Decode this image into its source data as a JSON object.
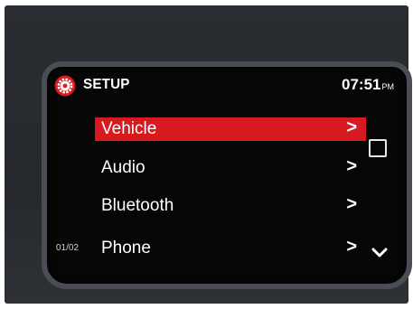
{
  "header": {
    "title": "SETUP",
    "time": "07:51",
    "ampm": "PM"
  },
  "menu": {
    "items": [
      {
        "label": "Vehicle",
        "chevron": ">",
        "selected": true
      },
      {
        "label": "Audio",
        "chevron": ">",
        "selected": false
      },
      {
        "label": "Bluetooth",
        "chevron": ">",
        "selected": false
      },
      {
        "label": "Phone",
        "chevron": ">",
        "selected": false
      }
    ]
  },
  "page_indicator": "01/02",
  "icons": {
    "header": "gear-icon",
    "side_top": "square-icon",
    "side_bottom": "chevron-down-icon"
  },
  "colors": {
    "accent": "#d71920",
    "background": "#060606",
    "text": "#ffffff"
  }
}
